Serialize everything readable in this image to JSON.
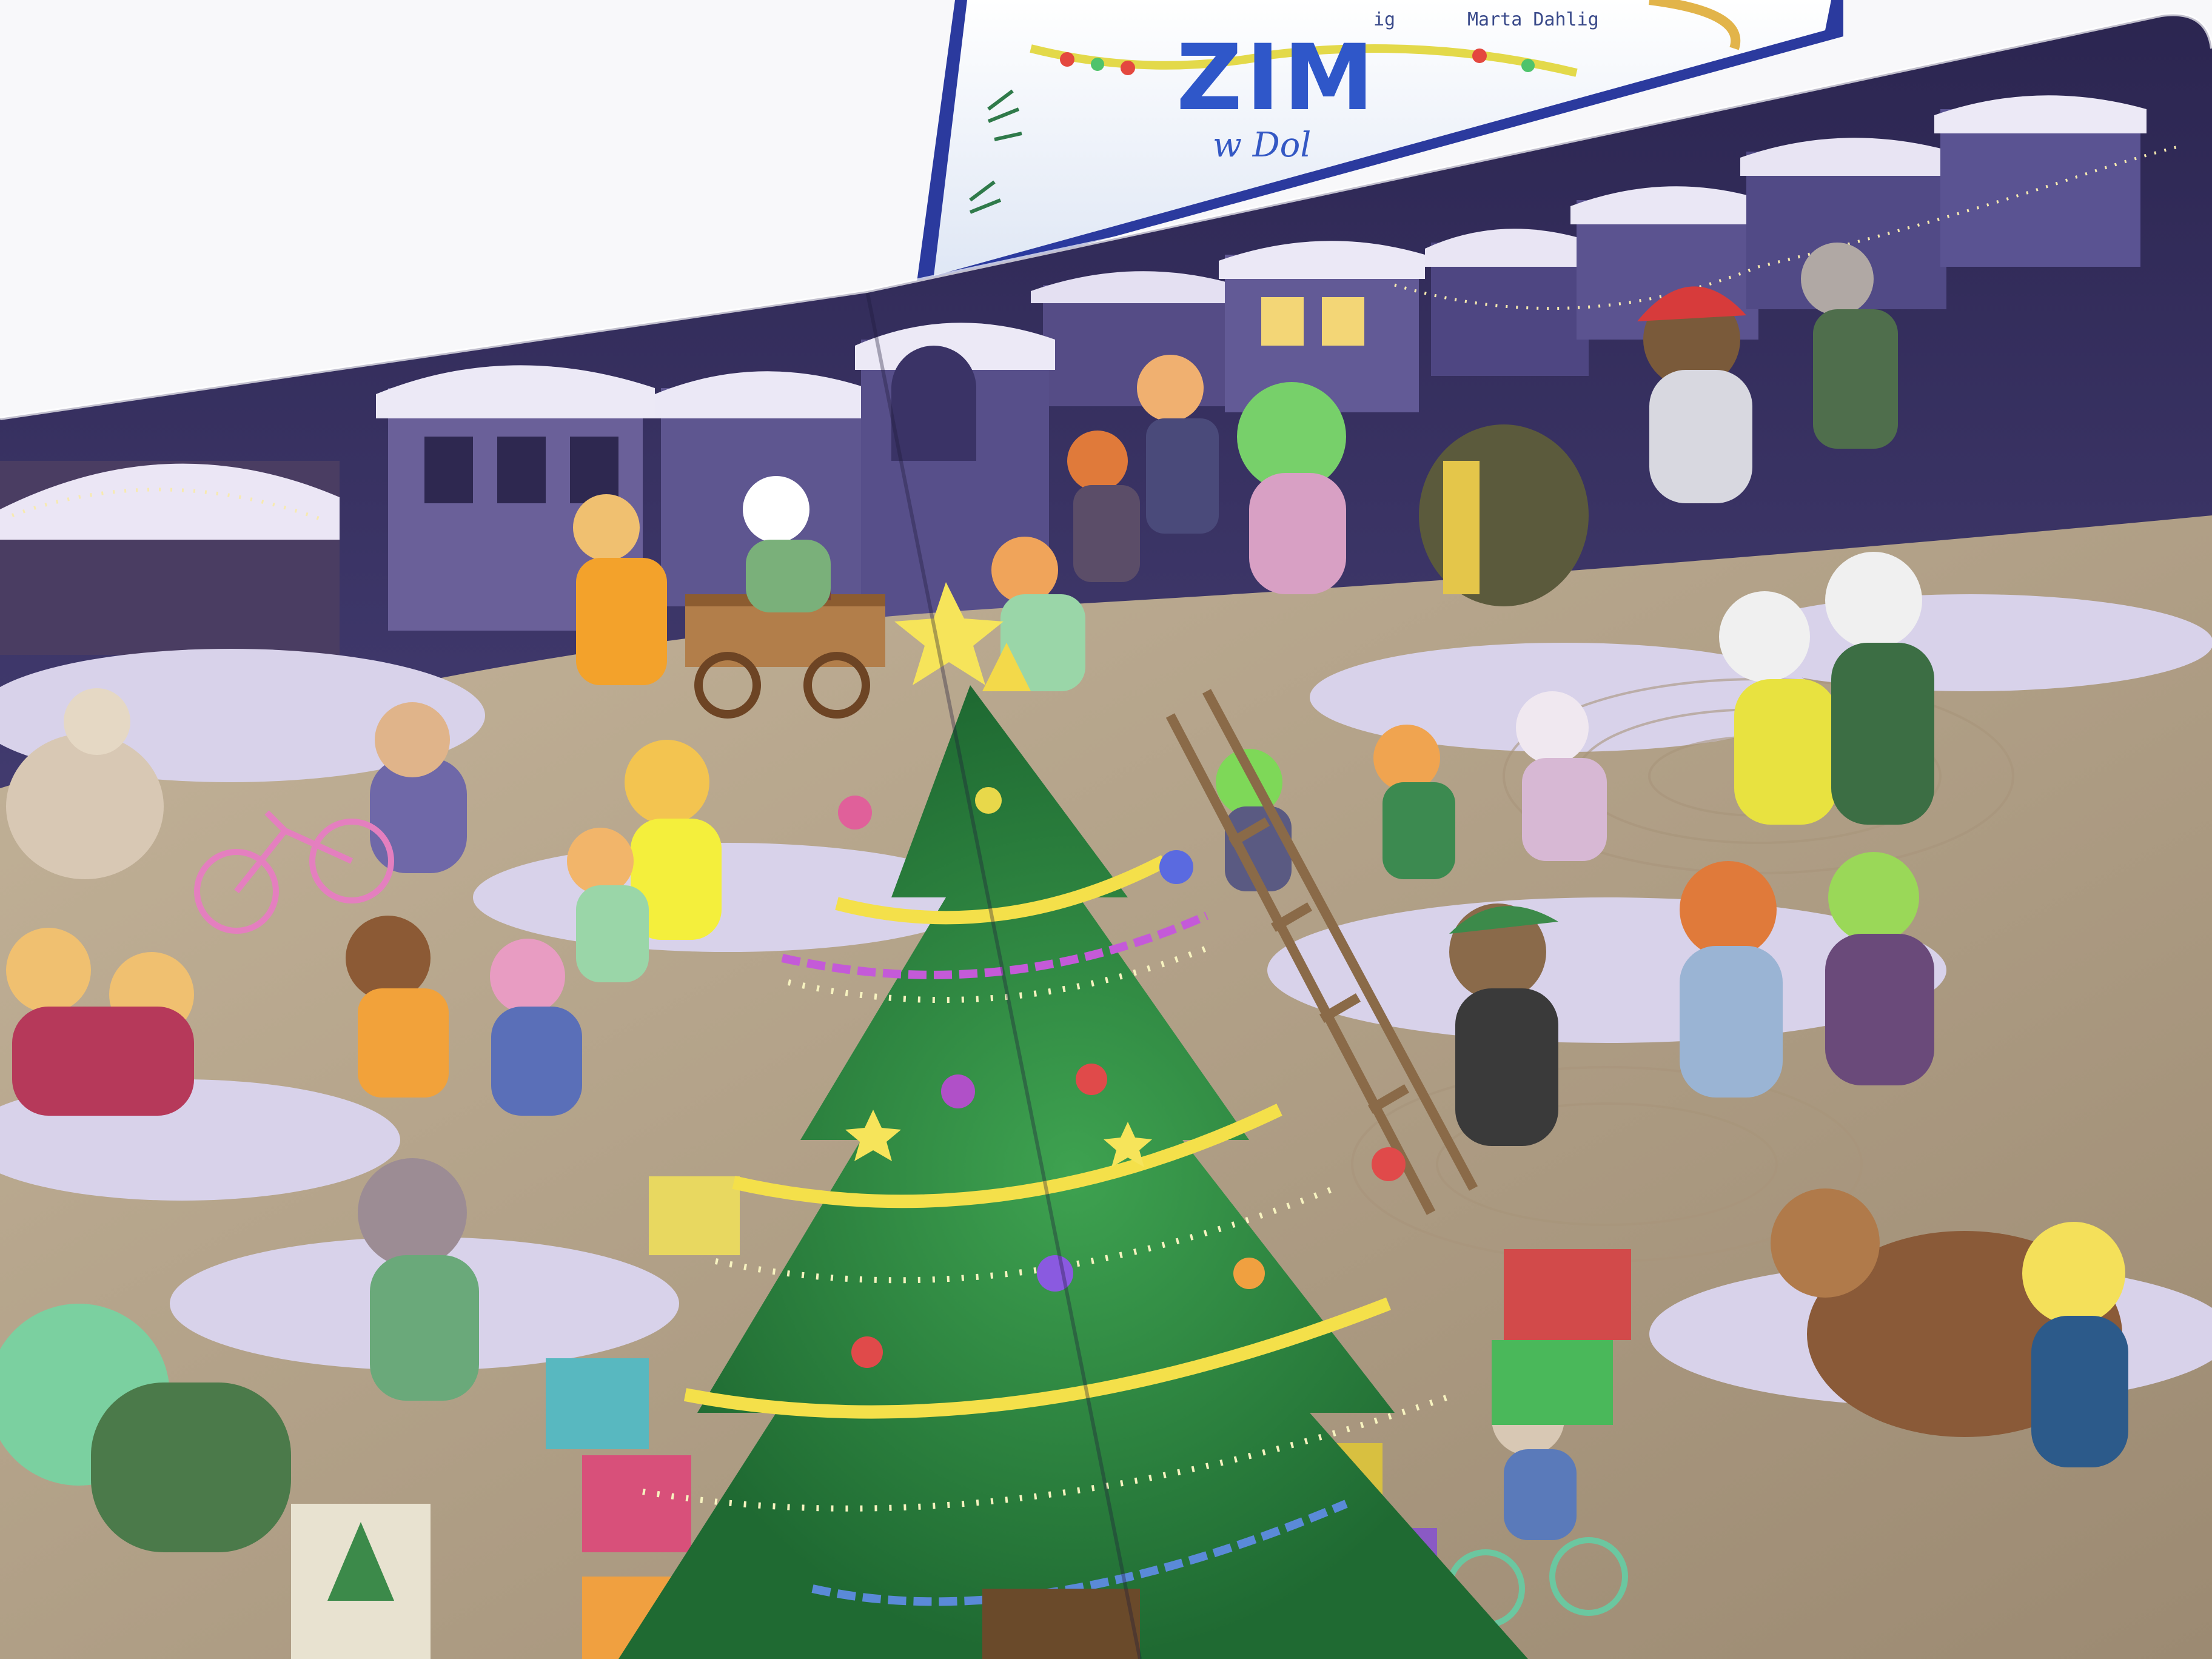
{
  "photo": {
    "cover_book": {
      "title_fragment": "ZIM",
      "subtitle_fragment": "w Dol",
      "author_visible": "Marta Dahlig",
      "author_left_fragment": "ig"
    },
    "open_page": {
      "scene": "winter-market-christmas-tree",
      "colors": {
        "page_bg": "#3a3560",
        "snow": "#d9d3ec",
        "cobblestone": "#b9a389",
        "tree": "#2e8a3f",
        "sky": "#2a2450"
      }
    }
  }
}
